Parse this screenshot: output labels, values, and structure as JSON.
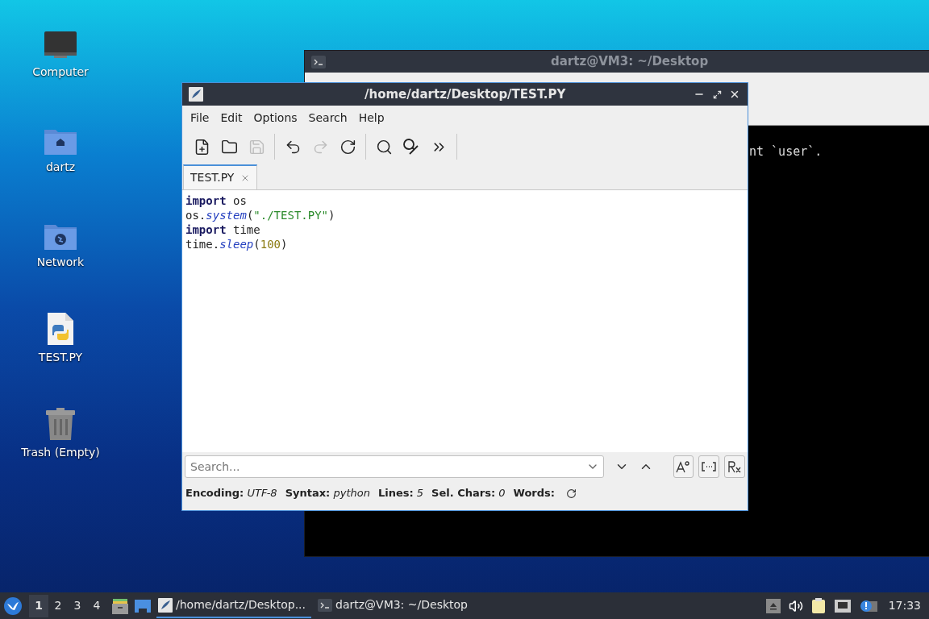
{
  "desktop_icons": [
    {
      "kind": "computer",
      "label": "Computer"
    },
    {
      "kind": "home",
      "label": "dartz"
    },
    {
      "kind": "network",
      "label": "Network"
    },
    {
      "kind": "python",
      "label": "TEST.PY"
    },
    {
      "kind": "trash",
      "label": "Trash (Empty)"
    }
  ],
  "terminal": {
    "title": "dartz@VM3: ~/Desktop",
    "output": "nt `user`."
  },
  "editor": {
    "title": "/home/dartz/Desktop/TEST.PY",
    "menu": [
      "File",
      "Edit",
      "Options",
      "Search",
      "Help"
    ],
    "toolbar": [
      {
        "kind": "new",
        "disabled": false
      },
      {
        "kind": "open",
        "disabled": false
      },
      {
        "kind": "save",
        "disabled": true
      },
      {
        "kind": "sep"
      },
      {
        "kind": "undo",
        "disabled": false
      },
      {
        "kind": "redo",
        "disabled": true
      },
      {
        "kind": "reload",
        "disabled": false
      },
      {
        "kind": "sep"
      },
      {
        "kind": "find",
        "disabled": false
      },
      {
        "kind": "replace",
        "disabled": false
      },
      {
        "kind": "more",
        "disabled": false
      },
      {
        "kind": "sep"
      }
    ],
    "tabs": [
      {
        "label": "TEST.PY",
        "selected": true
      }
    ],
    "code": [
      [
        {
          "kind": "keyword",
          "text": "import"
        },
        {
          "kind": "plain",
          "text": " os"
        }
      ],
      [
        {
          "kind": "plain",
          "text": "os."
        },
        {
          "kind": "function",
          "text": "system"
        },
        {
          "kind": "plain",
          "text": "("
        },
        {
          "kind": "string",
          "text": "\"./TEST.PY\""
        },
        {
          "kind": "plain",
          "text": ")"
        }
      ],
      [
        {
          "kind": "keyword",
          "text": "import"
        },
        {
          "kind": "plain",
          "text": " time"
        }
      ],
      [
        {
          "kind": "plain",
          "text": "time."
        },
        {
          "kind": "function",
          "text": "sleep"
        },
        {
          "kind": "plain",
          "text": "("
        },
        {
          "kind": "number",
          "text": "100"
        },
        {
          "kind": "plain",
          "text": ")"
        }
      ]
    ],
    "search": {
      "placeholder": "Search..."
    },
    "status": [
      {
        "label": "Encoding:",
        "value": "UTF-8"
      },
      {
        "label": "Syntax:",
        "value": "python"
      },
      {
        "label": "Lines:",
        "value": "5"
      },
      {
        "label": "Sel. Chars:",
        "value": "0"
      },
      {
        "label": "Words:"
      }
    ]
  },
  "taskbar": {
    "workspaces": [
      {
        "label": "1",
        "selected": true
      },
      {
        "label": "2",
        "selected": false
      },
      {
        "label": "3",
        "selected": false
      },
      {
        "label": "4",
        "selected": false
      }
    ],
    "tasks": [
      {
        "kind": "editor",
        "label": "/home/dartz/Desktop...",
        "selected": true
      },
      {
        "kind": "terminal",
        "label": "dartz@VM3: ~/Desktop",
        "selected": false
      }
    ],
    "clock": "17:33"
  }
}
